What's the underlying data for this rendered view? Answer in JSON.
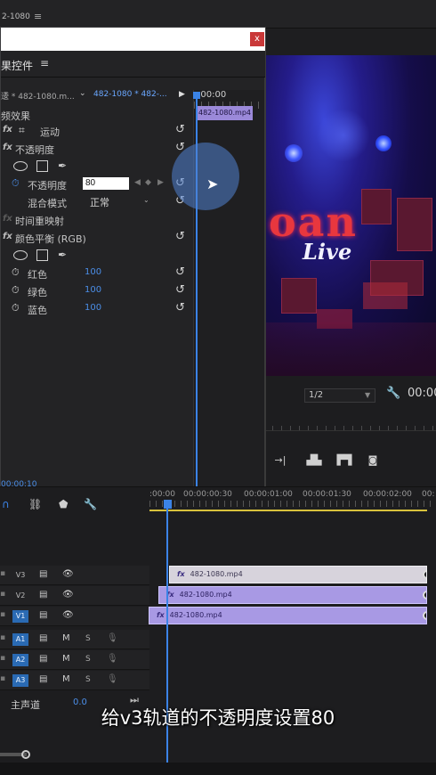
{
  "topbar": {
    "title": "2-1080",
    "menu_icon": "≡"
  },
  "effect_controls": {
    "panel_label": "果控件",
    "panel_menu_icon": "≡",
    "source_label": "逶 * 482-1080.m...",
    "clip_label": "482-1080 * 482-...",
    "timeline_start": ":00:00",
    "clip_bar_label": "482-1080.mp4",
    "section_label": "频效果",
    "fx_motion": "运动",
    "fx_opacity": "不透明度",
    "opacity_param": "不透明度",
    "opacity_value": "80",
    "blend_label": "混合模式",
    "blend_value": "正常",
    "time_remap": "时间重映射",
    "color_balance": "颜色平衡 (RGB)",
    "red_label": "红色",
    "red_value": "100",
    "green_label": "绿色",
    "green_value": "100",
    "blue_label": "蓝色",
    "blue_value": "100",
    "timecode": "00:00:10",
    "close_label": "x"
  },
  "program_monitor": {
    "zoom_value": "1/2",
    "timecode": "00:00",
    "neon_text": "oan",
    "neon_sub": "Live"
  },
  "timeline": {
    "ruler_labels": [
      ":00:00",
      "00:00:00:30",
      "00:00:01:00",
      "00:00:01:30",
      "00:00:02:00",
      "00:"
    ],
    "tracks": [
      {
        "label": "V3",
        "on": false,
        "clip": "482-1080.mp4"
      },
      {
        "label": "V2",
        "on": false,
        "clip": "482-1080.mp4"
      },
      {
        "label": "V1",
        "on": true,
        "clip": "482-1080.mp4"
      },
      {
        "label": "A1",
        "on": true,
        "m": "M",
        "s": "S"
      },
      {
        "label": "A2",
        "on": true,
        "m": "M",
        "s": "S"
      },
      {
        "label": "A3",
        "on": true,
        "m": "M",
        "s": "S"
      }
    ],
    "master_label": "主声道",
    "master_value": "0.0"
  },
  "subtitle": "给v3轨道的不透明度设置80",
  "colors": {
    "accent": "#3b83e6",
    "clip": "#a899e4",
    "value_blue": "#4b8ee8"
  }
}
